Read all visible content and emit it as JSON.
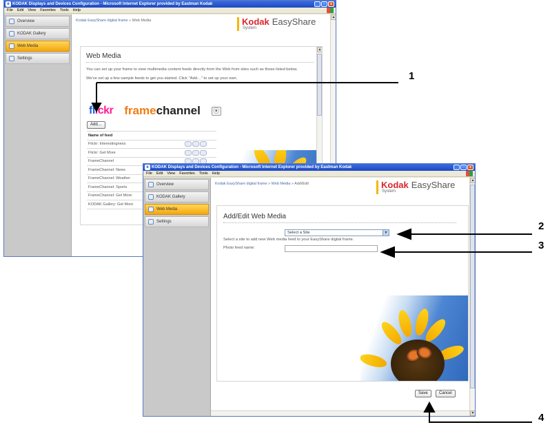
{
  "back_window": {
    "title": "KODAK Displays and Devices Configuration - Microsoft Internet Explorer provided by Eastman Kodak",
    "menu": [
      "File",
      "Edit",
      "View",
      "Favorites",
      "Tools",
      "Help"
    ],
    "sidebar": [
      "Overview",
      "KODAK Gallery",
      "Web Media",
      "Settings"
    ],
    "active_nav": "Web Media",
    "breadcrumb": {
      "link": "Kodak EasyShare digital frame",
      "sep": " » ",
      "current": "Web Media"
    },
    "logo": {
      "kodak": "Kodak",
      "easyshare": "EasyShare",
      "system": "System"
    },
    "heading": "Web Media",
    "intro": "You can set up your frame to view multimedia content feeds directly from the Web from sites such as those listed below.",
    "setup_text": "We've set up a few sample feeds to get you started. Click \"Add…\" to set up your own.",
    "brand_logos": {
      "flickr_blue": "fl",
      "flickr_pink": "ickr",
      "framechannel_a": "frame",
      "framechannel_b": "channel"
    },
    "add_button": "Add…",
    "table_header": "Name of feed",
    "feeds": [
      "Flickr: Interestingness",
      "Flickr: Get More",
      "FrameChannel",
      "FrameChannel: News",
      "FrameChannel: Weather",
      "FrameChannel: Sports",
      "FrameChannel: Get More",
      "KODAK Gallery: Get More"
    ]
  },
  "front_window": {
    "title": "KODAK Displays and Devices Configuration - Microsoft Internet Explorer provided by Eastman Kodak",
    "menu": [
      "File",
      "Edit",
      "View",
      "Favorites",
      "Tools",
      "Help"
    ],
    "sidebar": [
      "Overview",
      "KODAK Gallery",
      "Web Media",
      "Settings"
    ],
    "active_nav": "Web Media",
    "breadcrumb": {
      "link1": "Kodak EasyShare digital frame",
      "sep": " » ",
      "link2": "Web Media",
      "current": "Add/Edit"
    },
    "logo": {
      "kodak": "Kodak",
      "easyshare": "EasyShare",
      "system": "System"
    },
    "heading": "Add/Edit Web Media",
    "select_value": "Select a Site",
    "select_help": "Select a site to add new Web media feed to your EasyShare digital frame.",
    "feed_name_label": "Photo feed name:",
    "feed_name_value": "",
    "save_button": "Save",
    "cancel_button": "Cancel"
  },
  "callouts": [
    "1",
    "2",
    "3",
    "4"
  ],
  "colors": {
    "titlebar": "#1d48c0",
    "nav_active": "#f4a60d",
    "kodak_red": "#d9262c",
    "kodak_yellow": "#f7b500"
  }
}
